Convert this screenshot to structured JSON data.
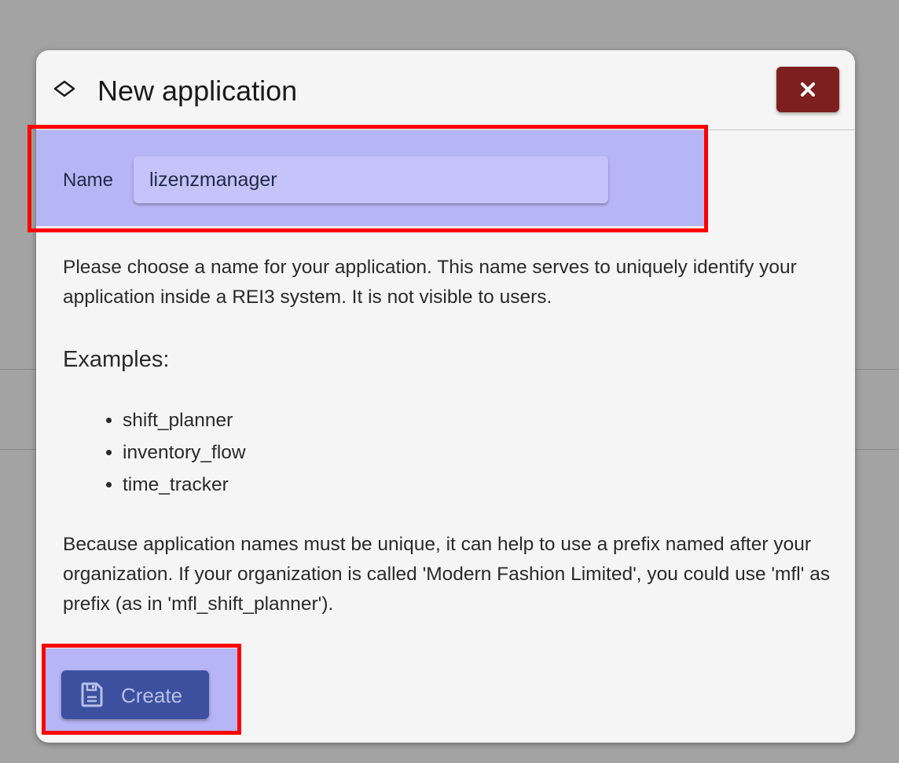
{
  "dialog": {
    "title": "New application",
    "title_icon": "diamond-outline-icon",
    "close_icon": "close-icon",
    "close_color": "#7e1f1f"
  },
  "form": {
    "name_label": "Name",
    "name_value": "lizenzmanager"
  },
  "help": {
    "intro": "Please choose a name for your application. This name serves to uniquely identify your application inside a REI3 system. It is not visible to users.",
    "examples_heading": "Examples:",
    "examples": [
      "shift_planner",
      "inventory_flow",
      "time_tracker"
    ],
    "prefix_note": "Because application names must be unique, it can help to use a prefix named after your organization. If your organization is called 'Modern Fashion Limited', you could use 'mfl' as prefix (as in 'mfl_shift_planner')."
  },
  "actions": {
    "create_label": "Create",
    "create_icon": "save-floppy-icon",
    "create_color": "#3d50a0"
  },
  "colors": {
    "highlight": "#b6b5f5",
    "annotation_border": "#ff0000"
  }
}
